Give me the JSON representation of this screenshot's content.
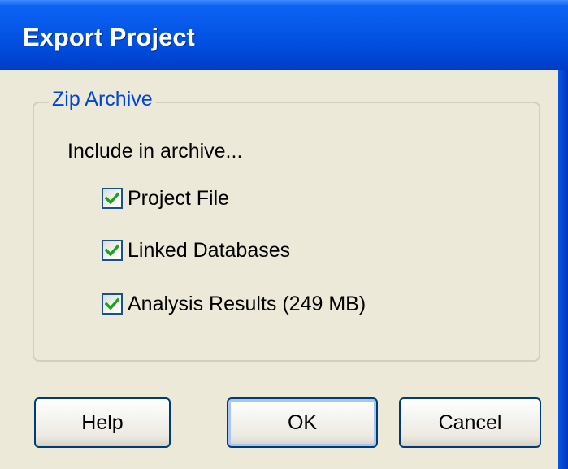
{
  "window": {
    "title": "Export Project"
  },
  "group": {
    "legend": "Zip Archive",
    "caption": "Include in archive..."
  },
  "options": [
    {
      "label": "Project File",
      "checked": true
    },
    {
      "label": "Linked Databases",
      "checked": true
    },
    {
      "label": "Analysis Results (249 MB)",
      "checked": true
    }
  ],
  "buttons": {
    "help": "Help",
    "ok": "OK",
    "cancel": "Cancel"
  },
  "colors": {
    "accent": "#0046d5",
    "check": "#21a121",
    "face": "#ece9d8"
  }
}
